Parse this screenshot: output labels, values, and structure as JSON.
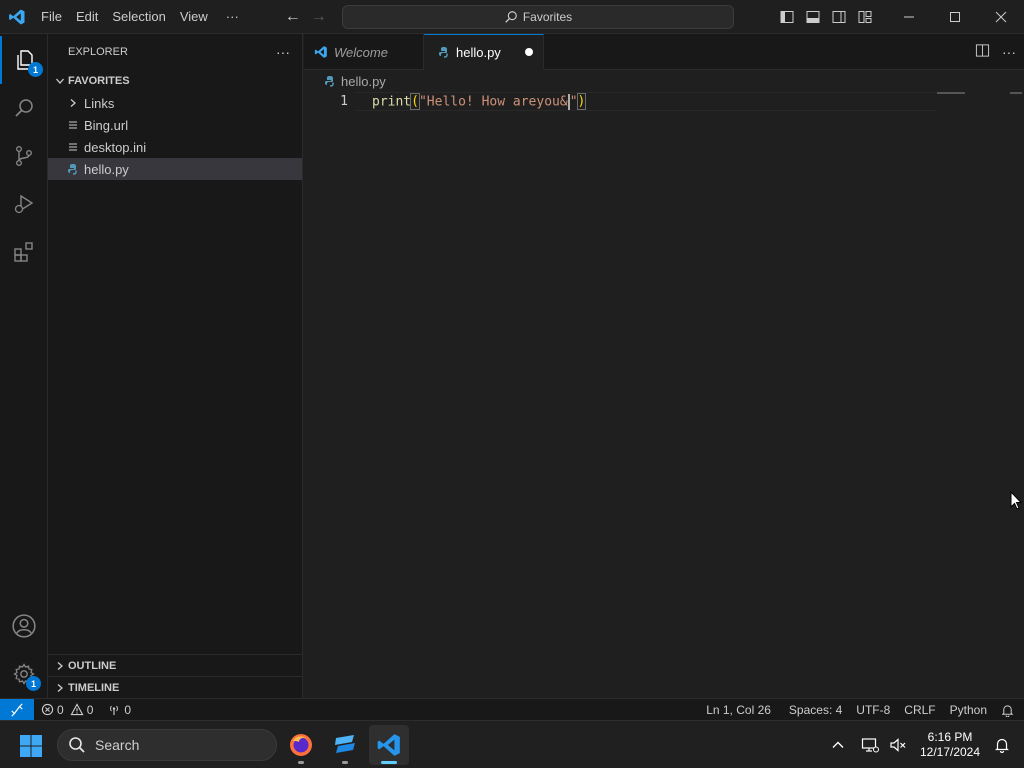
{
  "titlebar": {
    "menu": [
      "File",
      "Edit",
      "Selection",
      "View"
    ],
    "more": "···",
    "command_center": "Favorites"
  },
  "activitybar": {
    "explorer_badge": "1",
    "settings_badge": "1"
  },
  "sidebar": {
    "title": "EXPLORER",
    "more": "···",
    "folder": "FAVORITES",
    "items": [
      {
        "label": "Links",
        "type": "folder"
      },
      {
        "label": "Bing.url",
        "type": "file"
      },
      {
        "label": "desktop.ini",
        "type": "file"
      },
      {
        "label": "hello.py",
        "type": "python",
        "selected": true
      }
    ],
    "outline": "OUTLINE",
    "timeline": "TIMELINE"
  },
  "editor": {
    "tabs": [
      {
        "label": "Welcome",
        "active": false
      },
      {
        "label": "hello.py",
        "active": true,
        "dirty": true
      }
    ],
    "breadcrumb": "hello.py",
    "line_number": "1",
    "code": {
      "fn": "print",
      "open": "(",
      "str": "\"Hello! How areyou&",
      "close_quote": "\"",
      "close": ")"
    }
  },
  "statusbar": {
    "errors": "0",
    "warnings": "0",
    "ports": "0",
    "position": "Ln 1, Col 26",
    "spaces": "Spaces: 4",
    "encoding": "UTF-8",
    "eol": "CRLF",
    "language": "Python"
  },
  "taskbar": {
    "search_placeholder": "Search",
    "time": "6:16 PM",
    "date": "12/17/2024"
  },
  "colors": {
    "accent": "#0078d4",
    "function": "#dcdcaa",
    "string": "#ce9178",
    "bracket": "#ffd700"
  }
}
